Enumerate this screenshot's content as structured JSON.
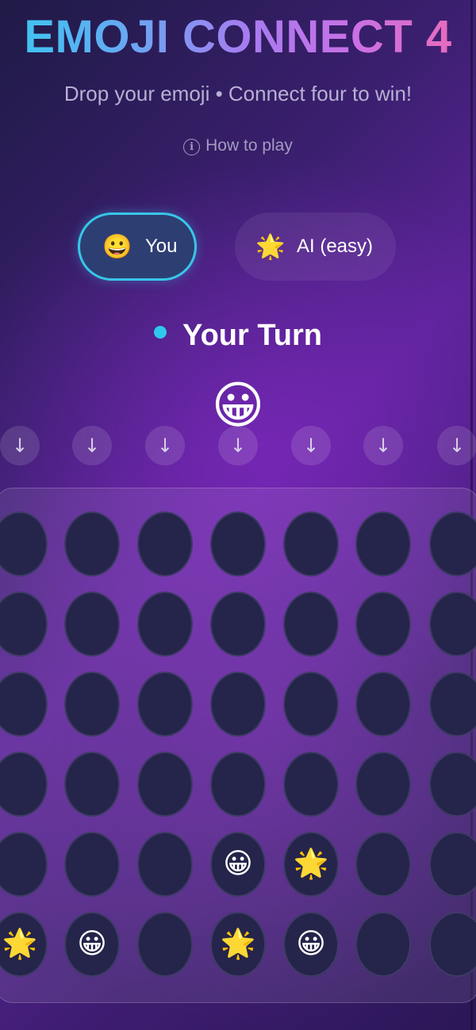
{
  "header": {
    "title": "EMOJI CONNECT 4",
    "subtitle": "Drop your emoji • Connect four to win!",
    "how_to_play": "How to play",
    "info_icon": "info-icon"
  },
  "players": [
    {
      "emoji": "😀",
      "label": "You",
      "active": true
    },
    {
      "emoji": "🌟",
      "label": "AI (easy)",
      "active": false
    }
  ],
  "status": {
    "text": "Your Turn",
    "dot_color": "#2fc8ec"
  },
  "hover_piece": "😀",
  "drop_arrow_icon": "↓",
  "columns": 7,
  "rows": 6,
  "board": [
    [
      "",
      "",
      "",
      "",
      "",
      "",
      ""
    ],
    [
      "",
      "",
      "",
      "",
      "",
      "",
      ""
    ],
    [
      "",
      "",
      "",
      "",
      "",
      "",
      ""
    ],
    [
      "",
      "",
      "",
      "",
      "",
      "",
      ""
    ],
    [
      "",
      "",
      "",
      "😀",
      "🌟",
      "",
      ""
    ],
    [
      "🌟",
      "😀",
      "",
      "🌟",
      "😀",
      "",
      ""
    ]
  ],
  "colors": {
    "accent_cyan": "#38c6e8",
    "title_gradient": [
      "#38c9f0",
      "#a77cf0",
      "#ee6bb2"
    ]
  }
}
